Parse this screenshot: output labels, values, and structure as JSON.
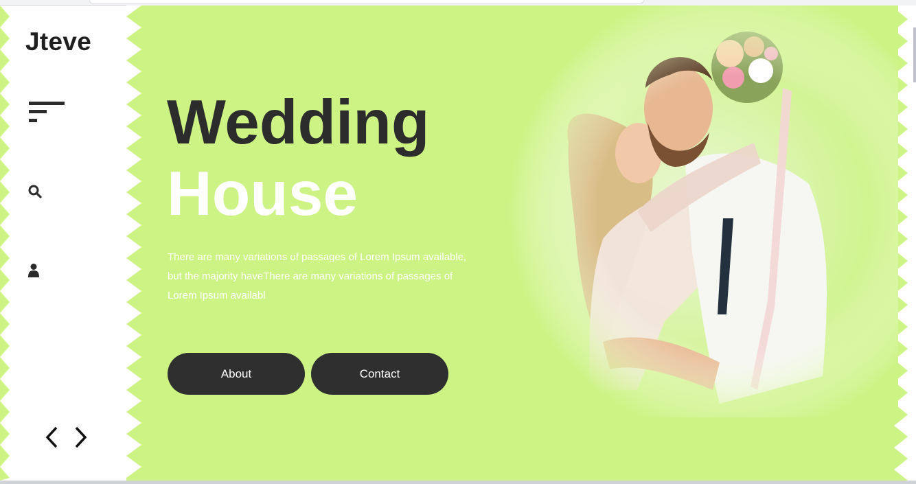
{
  "sidebar": {
    "brand": "Jteve",
    "icons": {
      "menu": "menu-icon",
      "search": "search-icon",
      "user": "user-icon",
      "prev": "chevron-left-icon",
      "next": "chevron-right-icon"
    }
  },
  "hero": {
    "title_line1": "Wedding",
    "title_line2": "House",
    "description": "There are many variations of passages of Lorem Ipsum available, but the majority haveThere are many variations of passages of Lorem Ipsum availabl",
    "buttons": {
      "about": "About",
      "contact": "Contact"
    },
    "image_alt": "wedding-couple-photo"
  },
  "colors": {
    "accent_green": "#ccf383",
    "dark": "#2c2c2c",
    "white": "#ffffff"
  }
}
